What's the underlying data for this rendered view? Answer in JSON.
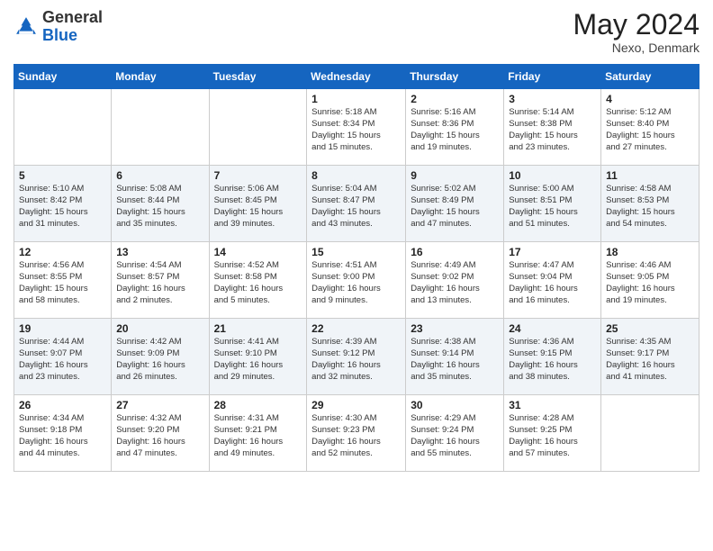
{
  "header": {
    "logo_general": "General",
    "logo_blue": "Blue",
    "month_year": "May 2024",
    "location": "Nexo, Denmark"
  },
  "weekdays": [
    "Sunday",
    "Monday",
    "Tuesday",
    "Wednesday",
    "Thursday",
    "Friday",
    "Saturday"
  ],
  "weeks": [
    [
      {
        "day": "",
        "info": ""
      },
      {
        "day": "",
        "info": ""
      },
      {
        "day": "",
        "info": ""
      },
      {
        "day": "1",
        "info": "Sunrise: 5:18 AM\nSunset: 8:34 PM\nDaylight: 15 hours\nand 15 minutes."
      },
      {
        "day": "2",
        "info": "Sunrise: 5:16 AM\nSunset: 8:36 PM\nDaylight: 15 hours\nand 19 minutes."
      },
      {
        "day": "3",
        "info": "Sunrise: 5:14 AM\nSunset: 8:38 PM\nDaylight: 15 hours\nand 23 minutes."
      },
      {
        "day": "4",
        "info": "Sunrise: 5:12 AM\nSunset: 8:40 PM\nDaylight: 15 hours\nand 27 minutes."
      }
    ],
    [
      {
        "day": "5",
        "info": "Sunrise: 5:10 AM\nSunset: 8:42 PM\nDaylight: 15 hours\nand 31 minutes."
      },
      {
        "day": "6",
        "info": "Sunrise: 5:08 AM\nSunset: 8:44 PM\nDaylight: 15 hours\nand 35 minutes."
      },
      {
        "day": "7",
        "info": "Sunrise: 5:06 AM\nSunset: 8:45 PM\nDaylight: 15 hours\nand 39 minutes."
      },
      {
        "day": "8",
        "info": "Sunrise: 5:04 AM\nSunset: 8:47 PM\nDaylight: 15 hours\nand 43 minutes."
      },
      {
        "day": "9",
        "info": "Sunrise: 5:02 AM\nSunset: 8:49 PM\nDaylight: 15 hours\nand 47 minutes."
      },
      {
        "day": "10",
        "info": "Sunrise: 5:00 AM\nSunset: 8:51 PM\nDaylight: 15 hours\nand 51 minutes."
      },
      {
        "day": "11",
        "info": "Sunrise: 4:58 AM\nSunset: 8:53 PM\nDaylight: 15 hours\nand 54 minutes."
      }
    ],
    [
      {
        "day": "12",
        "info": "Sunrise: 4:56 AM\nSunset: 8:55 PM\nDaylight: 15 hours\nand 58 minutes."
      },
      {
        "day": "13",
        "info": "Sunrise: 4:54 AM\nSunset: 8:57 PM\nDaylight: 16 hours\nand 2 minutes."
      },
      {
        "day": "14",
        "info": "Sunrise: 4:52 AM\nSunset: 8:58 PM\nDaylight: 16 hours\nand 5 minutes."
      },
      {
        "day": "15",
        "info": "Sunrise: 4:51 AM\nSunset: 9:00 PM\nDaylight: 16 hours\nand 9 minutes."
      },
      {
        "day": "16",
        "info": "Sunrise: 4:49 AM\nSunset: 9:02 PM\nDaylight: 16 hours\nand 13 minutes."
      },
      {
        "day": "17",
        "info": "Sunrise: 4:47 AM\nSunset: 9:04 PM\nDaylight: 16 hours\nand 16 minutes."
      },
      {
        "day": "18",
        "info": "Sunrise: 4:46 AM\nSunset: 9:05 PM\nDaylight: 16 hours\nand 19 minutes."
      }
    ],
    [
      {
        "day": "19",
        "info": "Sunrise: 4:44 AM\nSunset: 9:07 PM\nDaylight: 16 hours\nand 23 minutes."
      },
      {
        "day": "20",
        "info": "Sunrise: 4:42 AM\nSunset: 9:09 PM\nDaylight: 16 hours\nand 26 minutes."
      },
      {
        "day": "21",
        "info": "Sunrise: 4:41 AM\nSunset: 9:10 PM\nDaylight: 16 hours\nand 29 minutes."
      },
      {
        "day": "22",
        "info": "Sunrise: 4:39 AM\nSunset: 9:12 PM\nDaylight: 16 hours\nand 32 minutes."
      },
      {
        "day": "23",
        "info": "Sunrise: 4:38 AM\nSunset: 9:14 PM\nDaylight: 16 hours\nand 35 minutes."
      },
      {
        "day": "24",
        "info": "Sunrise: 4:36 AM\nSunset: 9:15 PM\nDaylight: 16 hours\nand 38 minutes."
      },
      {
        "day": "25",
        "info": "Sunrise: 4:35 AM\nSunset: 9:17 PM\nDaylight: 16 hours\nand 41 minutes."
      }
    ],
    [
      {
        "day": "26",
        "info": "Sunrise: 4:34 AM\nSunset: 9:18 PM\nDaylight: 16 hours\nand 44 minutes."
      },
      {
        "day": "27",
        "info": "Sunrise: 4:32 AM\nSunset: 9:20 PM\nDaylight: 16 hours\nand 47 minutes."
      },
      {
        "day": "28",
        "info": "Sunrise: 4:31 AM\nSunset: 9:21 PM\nDaylight: 16 hours\nand 49 minutes."
      },
      {
        "day": "29",
        "info": "Sunrise: 4:30 AM\nSunset: 9:23 PM\nDaylight: 16 hours\nand 52 minutes."
      },
      {
        "day": "30",
        "info": "Sunrise: 4:29 AM\nSunset: 9:24 PM\nDaylight: 16 hours\nand 55 minutes."
      },
      {
        "day": "31",
        "info": "Sunrise: 4:28 AM\nSunset: 9:25 PM\nDaylight: 16 hours\nand 57 minutes."
      },
      {
        "day": "",
        "info": ""
      }
    ]
  ]
}
